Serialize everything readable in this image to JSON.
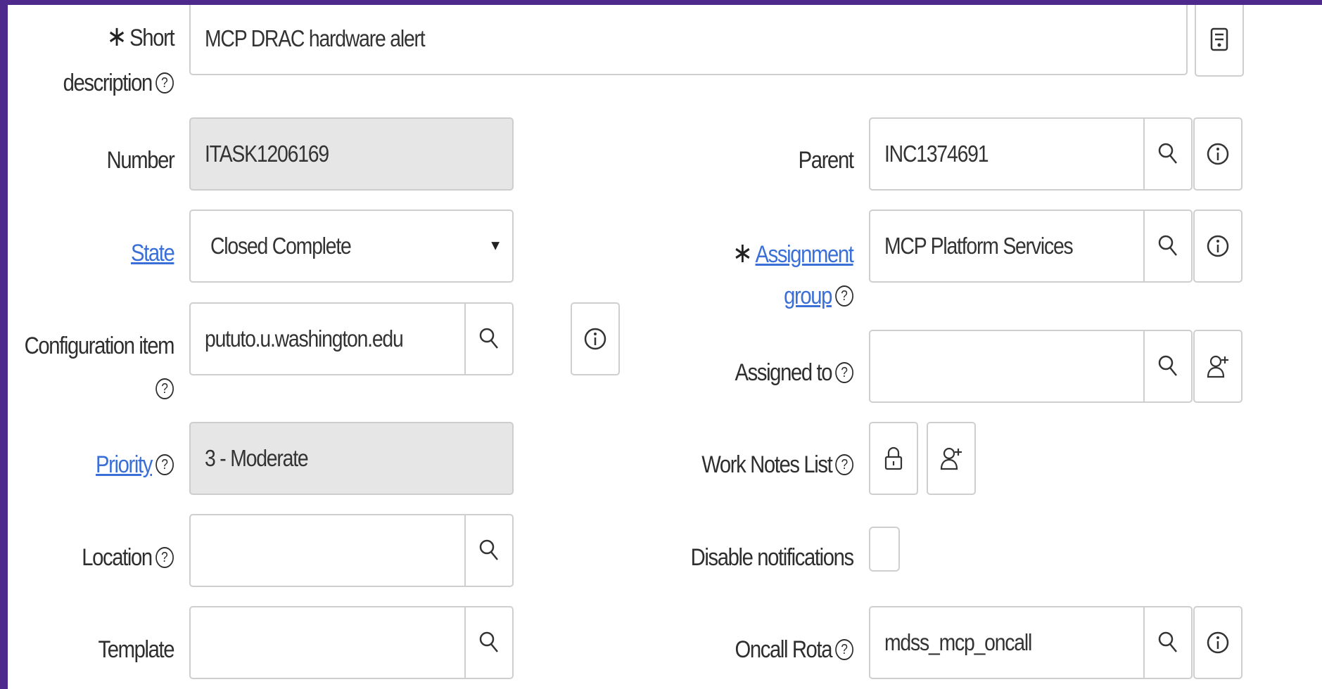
{
  "form": {
    "short_description": {
      "label_line1": "Short",
      "label_line2": "description",
      "value": "MCP DRAC hardware alert"
    },
    "number": {
      "label": "Number",
      "value": "ITASK1206169"
    },
    "state": {
      "label": "State",
      "value": "Closed Complete"
    },
    "configuration_item": {
      "label": "Configuration item",
      "value": "pututo.u.washington.edu"
    },
    "priority": {
      "label": "Priority",
      "value": "3 - Moderate"
    },
    "location": {
      "label": "Location",
      "value": ""
    },
    "template": {
      "label": "Template",
      "value": ""
    },
    "parent": {
      "label": "Parent",
      "value": "INC1374691"
    },
    "assignment_group": {
      "label_line1": "Assignment",
      "label_line2": "group",
      "value": "MCP Platform Services"
    },
    "assigned_to": {
      "label": "Assigned to",
      "value": ""
    },
    "work_notes_list": {
      "label": "Work Notes List"
    },
    "disable_notifications": {
      "label": "Disable notifications",
      "checked": false
    },
    "oncall_rota": {
      "label": "Oncall Rota",
      "value": "mdss_mcp_oncall"
    }
  },
  "glyphs": {
    "help": "?",
    "required": "∗",
    "select_caret": "▼"
  },
  "icons": [
    "template-icon",
    "search-icon",
    "info-icon",
    "add-user-icon",
    "lock-icon",
    "help-icon",
    "required-icon"
  ],
  "colors": {
    "link": "#3a6fd8",
    "frame_border": "#4d2a8c",
    "readonly_bg": "#e6e6e6"
  }
}
